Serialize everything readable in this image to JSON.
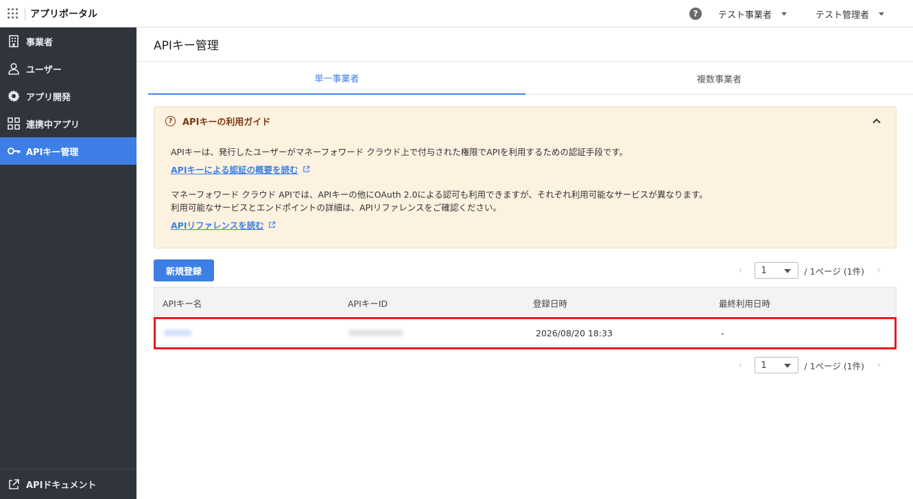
{
  "app": {
    "title": "アプリポータル"
  },
  "header": {
    "help_icon": "question-circle-icon",
    "org_menu": "テスト事業者",
    "user_menu": "テスト管理者"
  },
  "sidebar": {
    "items": [
      {
        "label": "事業者",
        "icon": "building-icon",
        "active": false
      },
      {
        "label": "ユーザー",
        "icon": "user-icon",
        "active": false
      },
      {
        "label": "アプリ開発",
        "icon": "gear-icon",
        "active": false
      },
      {
        "label": "連携中アプリ",
        "icon": "apps-grid-icon",
        "active": false
      },
      {
        "label": "APIキー管理",
        "icon": "key-icon",
        "active": true
      }
    ],
    "bottom_link": "APIドキュメント"
  },
  "main": {
    "page_title": "APIキー管理",
    "tabs": [
      {
        "label": "単一事業者",
        "active": true
      },
      {
        "label": "複数事業者",
        "active": false
      }
    ],
    "guide": {
      "title": "APIキーの利用ガイド",
      "paragraph1": "APIキーは、発行したユーザーがマネーフォワード クラウド上で付与された権限でAPIを利用するための認証手段です。",
      "link1": "APIキーによる認証の概要を読む",
      "paragraph2_line1": "マネーフォワード クラウド APIでは、APIキーの他にOAuth 2.0による認可も利用できますが、それぞれ利用可能なサービスが異なります。",
      "paragraph2_line2": "利用可能なサービスとエンドポイントの詳細は、APIリファレンスをご確認ください。",
      "link2": "APIリファレンスを読む"
    },
    "new_button": "新規登録",
    "pagination": {
      "current_page": "1",
      "summary": "/ 1ページ (1件)"
    },
    "table": {
      "columns": [
        "APIキー名",
        "APIキーID",
        "登録日時",
        "最終利用日時"
      ],
      "rows": [
        {
          "name": "",
          "id": "",
          "created_at": "2026/08/20 18:33",
          "last_used": "-"
        }
      ]
    }
  },
  "colors": {
    "accent": "#3d7fe6",
    "sidebar_bg": "#30343c",
    "guide_bg": "#fdf1e0",
    "highlight": "#e8191c"
  }
}
